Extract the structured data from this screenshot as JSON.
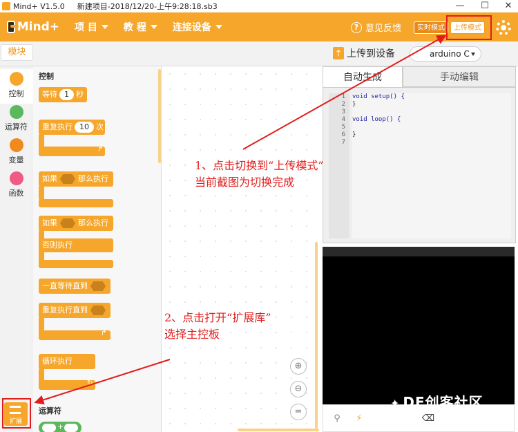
{
  "window": {
    "app_title": "Mind+ V1.5.0",
    "file_title": "新建项目-2018/12/20-上午9:28:18.sb3",
    "minimize": "—",
    "maximize": "☐",
    "close": "✕"
  },
  "header": {
    "logo_text": "Mind+",
    "menus": [
      {
        "label": "项 目"
      },
      {
        "label": "教 程"
      },
      {
        "label": "连接设备"
      }
    ],
    "feedback_label": "意见反馈",
    "live_mode_label": "实时模式",
    "upload_mode_label": "上传模式",
    "accent_color": "#f6a62a"
  },
  "toolbar": {
    "modules_tab": "模块",
    "upload_to_device": "上传到设备",
    "board_selected": "arduino C"
  },
  "categories": [
    {
      "label": "控制",
      "color": "#f6a62a"
    },
    {
      "label": "运算符",
      "color": "#5cb85c"
    },
    {
      "label": "变量",
      "color": "#f08a1e"
    },
    {
      "label": "函数",
      "color": "#ef5b84"
    }
  ],
  "extension_label": "扩展",
  "palette": {
    "section_control": "控制",
    "wait_label": "等待",
    "wait_value": "1",
    "wait_unit": "秒",
    "repeat_label": "重复执行",
    "repeat_value": "10",
    "repeat_unit": "次",
    "if_label": "如果",
    "then_label": "那么执行",
    "if2_label": "如果",
    "then2_label": "那么执行",
    "else_label": "否则执行",
    "wait_until_label": "一直等待直到",
    "repeat_until_label": "重复执行直到",
    "forever_label": "循环执行",
    "section_operators": "运算符",
    "plus_sign": "+"
  },
  "code_panel": {
    "tab_auto": "自动生成",
    "tab_manual": "手动编辑",
    "line_numbers": [
      "1",
      "2",
      "3",
      "4",
      "5",
      "6",
      "7"
    ],
    "lines": [
      "void setup() {",
      "}",
      "",
      "void loop() {",
      "",
      "}",
      ""
    ]
  },
  "watermark": "DF创客社区",
  "annotations": {
    "step1_line1": "1、点击切换到“上传模式”",
    "step1_line2": "当前截图为切换完成",
    "step2_line1": "2、点击打开“扩展库”",
    "step2_line2": "选择主控板"
  }
}
